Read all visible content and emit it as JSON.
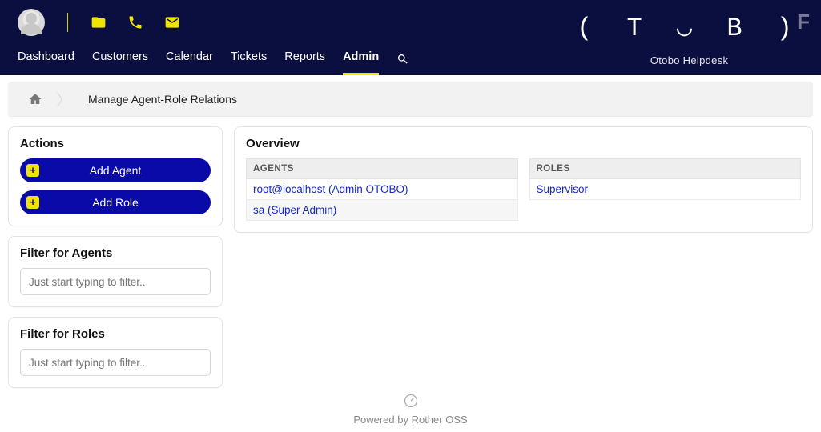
{
  "brand": {
    "name": "OTOBO",
    "tagline": "Otobo Helpdesk"
  },
  "nav": {
    "items": [
      {
        "label": "Dashboard",
        "active": false
      },
      {
        "label": "Customers",
        "active": false
      },
      {
        "label": "Calendar",
        "active": false
      },
      {
        "label": "Tickets",
        "active": false
      },
      {
        "label": "Reports",
        "active": false
      },
      {
        "label": "Admin",
        "active": true
      }
    ]
  },
  "breadcrumb": {
    "current": "Manage Agent-Role Relations"
  },
  "sidebar": {
    "actions": {
      "title": "Actions",
      "add_agent": "Add Agent",
      "add_role": "Add Role"
    },
    "filter_agents": {
      "title": "Filter for Agents",
      "placeholder": "Just start typing to filter..."
    },
    "filter_roles": {
      "title": "Filter for Roles",
      "placeholder": "Just start typing to filter..."
    }
  },
  "overview": {
    "title": "Overview",
    "agents_header": "AGENTS",
    "roles_header": "ROLES",
    "agents": [
      "root@localhost (Admin OTOBO)",
      "sa (Super Admin)"
    ],
    "roles": [
      "Supervisor"
    ]
  },
  "footer": {
    "text": "Powered by Rother OSS"
  }
}
